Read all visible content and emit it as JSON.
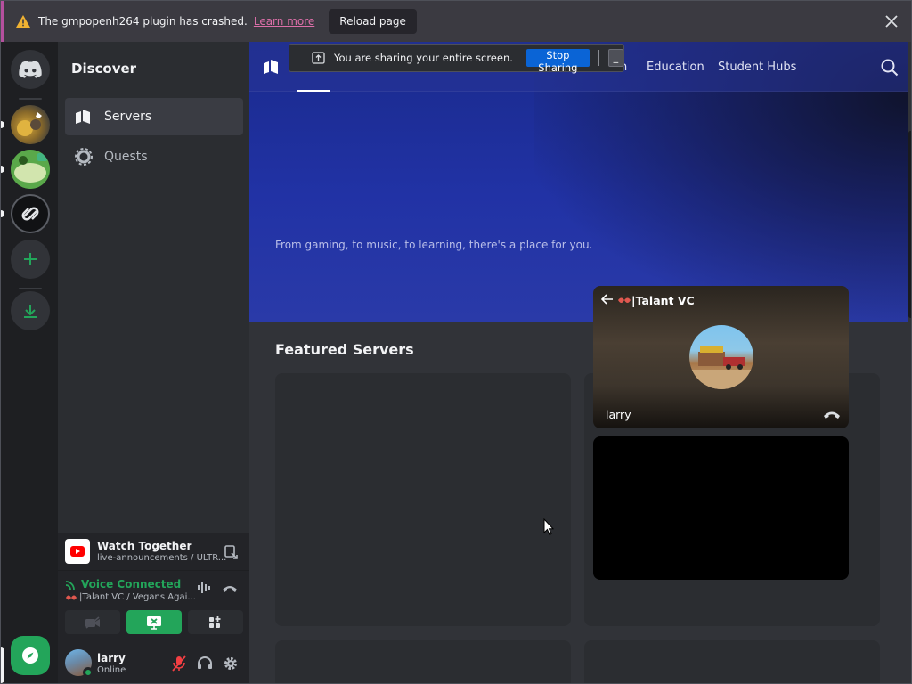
{
  "crash_banner": {
    "message": "The gmpopenh264 plugin has crashed.",
    "link_label": "Learn more",
    "reload_label": "Reload page"
  },
  "screen_share": {
    "message": "You are sharing your entire screen.",
    "stop_label": "Stop Sharing",
    "minimize_label": "_"
  },
  "sidebar": {
    "title": "Discover",
    "items": [
      {
        "label": "Servers",
        "icon": "servers-icon",
        "active": true
      },
      {
        "label": "Quests",
        "icon": "quests-icon",
        "active": false
      }
    ]
  },
  "topnav": {
    "tabs": [
      {
        "label": "h"
      },
      {
        "label": "Education"
      },
      {
        "label": "Student Hubs"
      }
    ]
  },
  "hero": {
    "subtitle": "From gaming, to music, to learning, there's a place for you."
  },
  "featured": {
    "heading": "Featured Servers"
  },
  "pip": {
    "channel": "|Talant VC",
    "user": "larry"
  },
  "activity": {
    "title": "Watch Together",
    "subtitle": "live-announcements / ULTR..."
  },
  "voice": {
    "status": "Voice Connected",
    "channel": "|Talant VC / Vegans Agai..."
  },
  "user": {
    "name": "larry",
    "status": "Online"
  },
  "colors": {
    "brand": "#5865f2",
    "green": "#23a55a",
    "link_pink": "#dd6fa9",
    "share_blue": "#0a64d6"
  }
}
